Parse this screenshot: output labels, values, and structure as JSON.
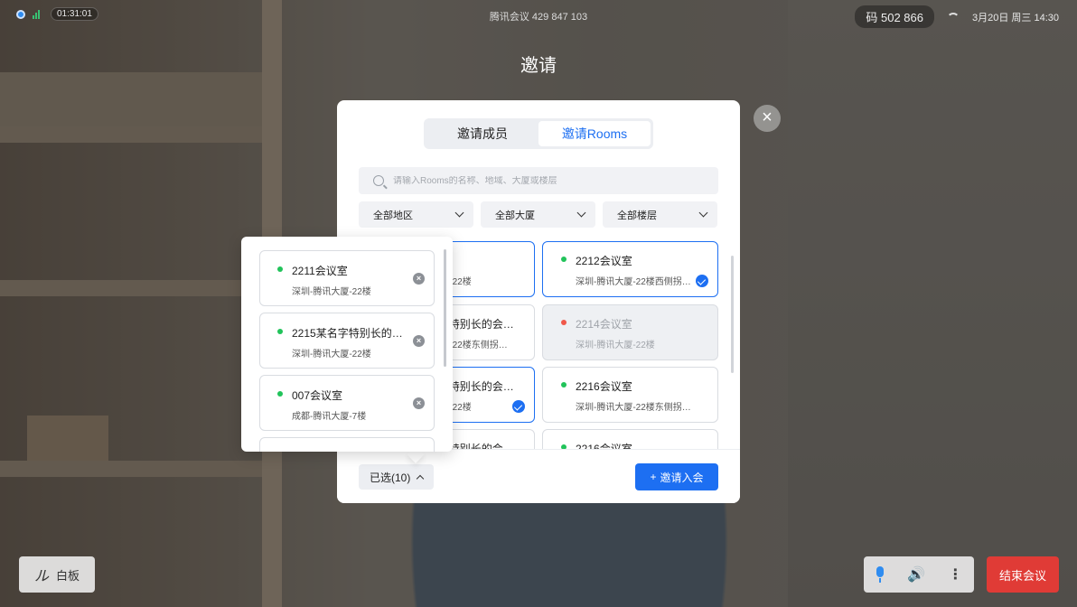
{
  "status_bar": {
    "timer": "01:31:01",
    "meeting_title": "腾讯会议 429 847 103",
    "meeting_code": "码 502 866",
    "datetime": "3月20日 周三 14:30"
  },
  "page_title": "邀请",
  "dialog": {
    "tabs": [
      {
        "label": "邀请成员",
        "active": false
      },
      {
        "label": "邀请Rooms",
        "active": true
      }
    ],
    "search": {
      "placeholder": "请输入Rooms的名称、地域、大厦或楼层",
      "value": ""
    },
    "filters": [
      {
        "label": "全部地区"
      },
      {
        "label": "全部大厦"
      },
      {
        "label": "全部楼层"
      }
    ],
    "rooms": [
      {
        "name": "2211会议室",
        "address": "深圳-腾讯大厦-22楼",
        "status": "available",
        "selected": true
      },
      {
        "name": "2212会议室",
        "address": "深圳-腾讯大厦-22楼西侧拐角处",
        "status": "available",
        "selected": true
      },
      {
        "name": "2215某名字特别长的会议室",
        "address": "深圳-腾讯大厦-22楼东侧拐角处",
        "status": "available",
        "selected": true
      },
      {
        "name": "2214会议室",
        "address": "深圳-腾讯大厦-22楼",
        "status": "busy",
        "selected": false
      },
      {
        "name": "2215某名字特别长的会议室",
        "address": "深圳-腾讯大厦-22楼",
        "status": "available",
        "selected": true
      },
      {
        "name": "2216会议室",
        "address": "深圳-腾讯大厦-22楼东侧拐角处",
        "status": "available",
        "selected": false
      },
      {
        "name": "2215某名字特别长的会议室",
        "address": "",
        "status": "available",
        "selected": false
      },
      {
        "name": "2216会议室",
        "address": "",
        "status": "available",
        "selected": false
      }
    ],
    "selected_button": "已选(10)",
    "invite_button": "邀请入会",
    "invite_plus": "+"
  },
  "selected_popover": {
    "items": [
      {
        "name": "2211会议室",
        "address": "深圳-腾讯大厦-22楼"
      },
      {
        "name": "2215某名字特别长的会议室",
        "address": "深圳-腾讯大厦-22楼"
      },
      {
        "name": "007会议室",
        "address": "成都-腾讯大厦-7楼"
      }
    ]
  },
  "controls": {
    "whiteboard": "白板",
    "end_meeting": "结束会议",
    "end_color": "#e03b36",
    "accent_color": "#1d6ff2"
  },
  "icons": {
    "close": "×",
    "remove": "×",
    "speaker": "🔊",
    "more": "⋮",
    "pen": "ル"
  }
}
